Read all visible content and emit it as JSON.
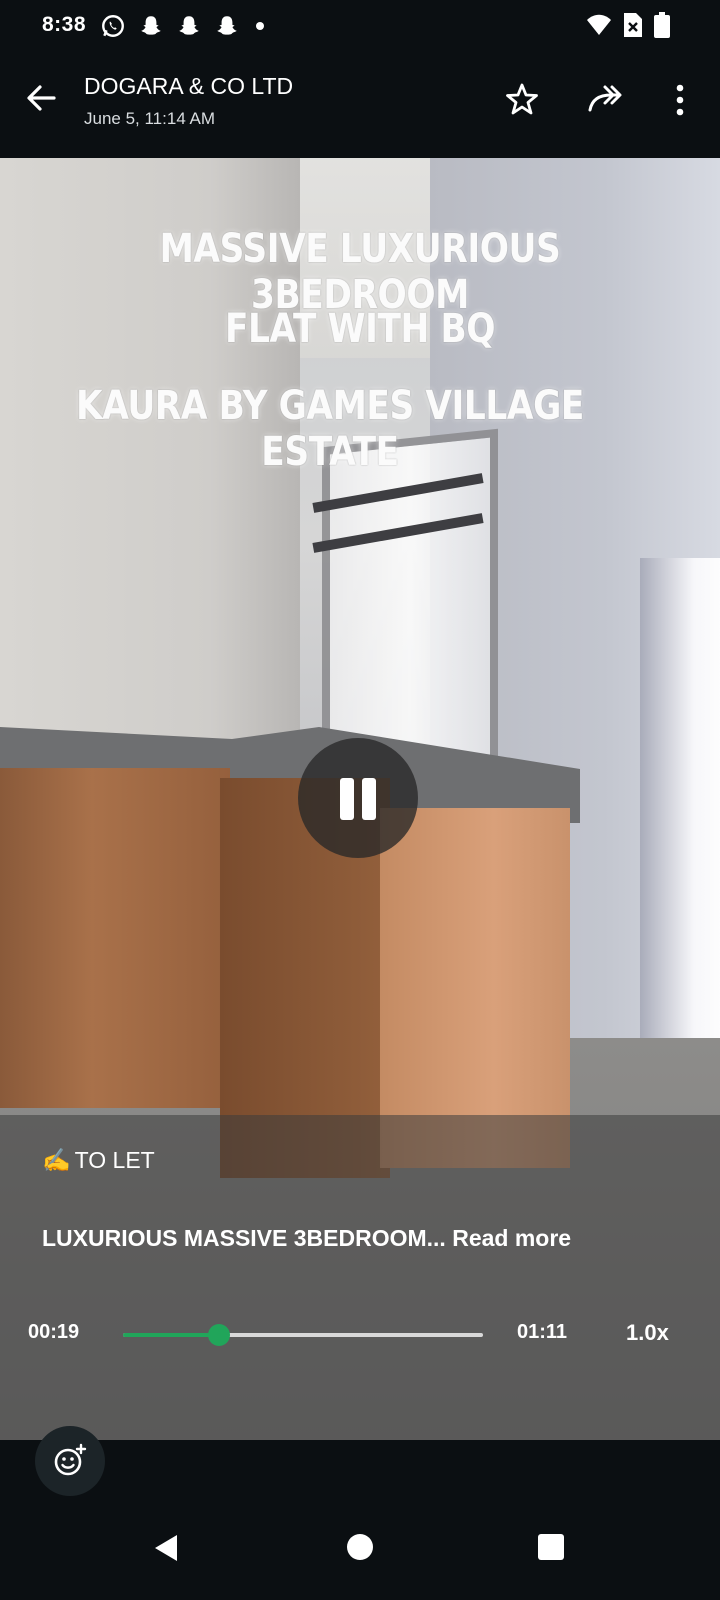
{
  "status_bar": {
    "time": "8:38",
    "left_icons": [
      "whatsapp-icon",
      "snapchat-icon",
      "snapchat-icon",
      "snapchat-icon",
      "more-notifications-dot"
    ],
    "right_icons": [
      "wifi-icon",
      "sim-icon",
      "battery-icon"
    ]
  },
  "header": {
    "title": "DOGARA & CO LTD",
    "subtitle": "June 5, 11:14 AM",
    "actions": [
      "back-arrow-icon",
      "star-icon",
      "forward-icon",
      "more-vertical-icon"
    ]
  },
  "video": {
    "overlay_lines": [
      "MASSIVE LUXURIOUS 3BEDROOM",
      "FLAT WITH BQ",
      "KAURA BY GAMES VILLAGE ESTATE"
    ],
    "state": "playing"
  },
  "caption": {
    "tag": "TO LET",
    "tag_emoji": "✍️",
    "text": "LUXURIOUS MASSIVE 3BEDROOM...",
    "read_more": "Read more"
  },
  "player": {
    "current_time": "00:19",
    "total_time": "01:11",
    "progress": 0.267,
    "speed": "1.0x",
    "accent_color": "#21a55a"
  },
  "nav_bar": {
    "buttons": [
      "nav-back-icon",
      "nav-home-icon",
      "nav-recent-icon"
    ]
  }
}
